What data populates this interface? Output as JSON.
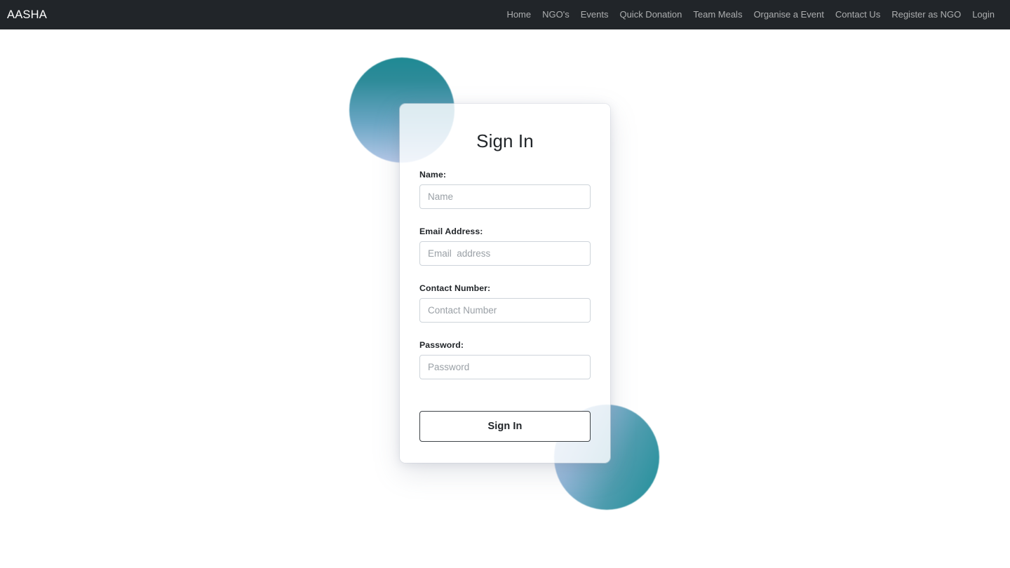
{
  "navbar": {
    "brand": "AASHA",
    "links": [
      {
        "label": "Home"
      },
      {
        "label": "NGO's"
      },
      {
        "label": "Events"
      },
      {
        "label": "Quick Donation"
      },
      {
        "label": "Team Meals"
      },
      {
        "label": "Organise a Event"
      },
      {
        "label": "Contact Us"
      },
      {
        "label": "Register as NGO"
      },
      {
        "label": "Login"
      }
    ],
    "background_color": "#212529",
    "text_color": "#ffffff"
  },
  "card": {
    "title": "Sign In",
    "fields": [
      {
        "label": "Name:",
        "placeholder": "Name",
        "value": "",
        "type": "text"
      },
      {
        "label": "Email Address:",
        "placeholder": "Email  address",
        "value": "",
        "type": "email"
      },
      {
        "label": "Contact Number:",
        "placeholder": "Contact Number",
        "value": "",
        "type": "tel"
      },
      {
        "label": "Password:",
        "placeholder": "Password",
        "value": "",
        "type": "password"
      }
    ],
    "submit_label": "Sign In"
  },
  "decor": {
    "circle_top": {
      "gradient_from": "#1f8a94",
      "gradient_to": "#b6c9e9"
    },
    "circle_bottom": {
      "gradient_from": "#b8caea",
      "gradient_to": "#1f8f99"
    }
  },
  "page": {
    "background_color": "#ffffff"
  }
}
